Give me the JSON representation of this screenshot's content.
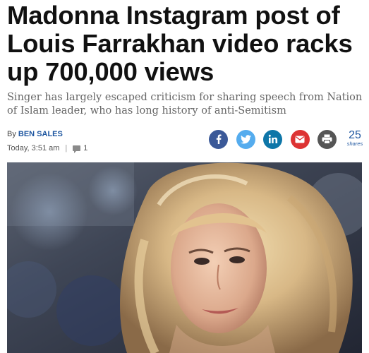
{
  "article": {
    "headline": "Madonna Instagram post of Louis Farrakhan video racks up 700,000 views",
    "subhead": "Singer has largely escaped criticism for sharing speech from Nation of Islam leader, who has long history of anti-Semitism",
    "byline_prefix": "By",
    "author": "BEN SALES",
    "timestamp": "Today, 3:51 am",
    "separator": "|",
    "comment_count": "1"
  },
  "share": {
    "buttons": [
      {
        "name": "facebook",
        "icon": "facebook-icon",
        "color": "#3b5998"
      },
      {
        "name": "twitter",
        "icon": "twitter-icon",
        "color": "#55acee"
      },
      {
        "name": "linkedin",
        "icon": "linkedin-icon",
        "color": "#0e76a8"
      },
      {
        "name": "email",
        "icon": "envelope-icon",
        "color": "#dd3333"
      },
      {
        "name": "print",
        "icon": "printer-icon",
        "color": "#555555"
      }
    ],
    "count": "25",
    "count_label": "shares"
  },
  "colors": {
    "headline": "#111111",
    "subhead": "#666666",
    "author_link": "#1e56a0"
  }
}
